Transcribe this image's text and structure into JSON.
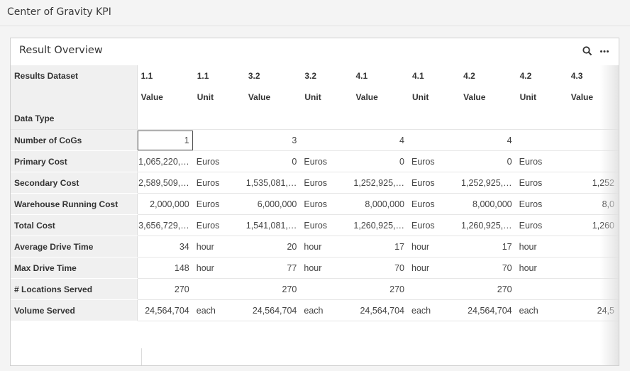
{
  "app": {
    "title": "Center of Gravity KPI"
  },
  "widget": {
    "title": "Result Overview",
    "search_icon": "search-icon",
    "more_icon": "more-icon"
  },
  "grid": {
    "header_rows": [
      {
        "label": "Results Dataset",
        "cells": [
          "1.1",
          "1.1",
          "3.2",
          "3.2",
          "4.1",
          "4.1",
          "4.2",
          "4.2",
          "4.3"
        ]
      },
      {
        "label": "",
        "cells": [
          "Value",
          "Unit",
          "Value",
          "Unit",
          "Value",
          "Unit",
          "Value",
          "Unit",
          "Value"
        ]
      },
      {
        "label": "Data Type",
        "cells": [
          "",
          "",
          "",
          "",
          "",
          "",
          "",
          "",
          ""
        ]
      }
    ],
    "rows": [
      {
        "label": "Number of CoGs",
        "cells": [
          "1",
          "",
          "3",
          "",
          "4",
          "",
          "4",
          "",
          ""
        ]
      },
      {
        "label": "Primary Cost",
        "cells": [
          "1,065,220,…",
          "Euros",
          "0",
          "Euros",
          "0",
          "Euros",
          "0",
          "Euros",
          ""
        ]
      },
      {
        "label": "Secondary Cost",
        "cells": [
          "2,589,509,…",
          "Euros",
          "1,535,081,…",
          "Euros",
          "1,252,925,…",
          "Euros",
          "1,252,925,…",
          "Euros",
          "1,252"
        ]
      },
      {
        "label": "Warehouse Running Cost",
        "cells": [
          "2,000,000",
          "Euros",
          "6,000,000",
          "Euros",
          "8,000,000",
          "Euros",
          "8,000,000",
          "Euros",
          "8,0"
        ]
      },
      {
        "label": "Total Cost",
        "cells": [
          "3,656,729,…",
          "Euros",
          "1,541,081,…",
          "Euros",
          "1,260,925,…",
          "Euros",
          "1,260,925,…",
          "Euros",
          "1,260"
        ]
      },
      {
        "label": "Average Drive Time",
        "cells": [
          "34",
          "hour",
          "20",
          "hour",
          "17",
          "hour",
          "17",
          "hour",
          ""
        ]
      },
      {
        "label": "Max Drive Time",
        "cells": [
          "148",
          "hour",
          "77",
          "hour",
          "70",
          "hour",
          "70",
          "hour",
          ""
        ]
      },
      {
        "label": "# Locations Served",
        "cells": [
          "270",
          "",
          "270",
          "",
          "270",
          "",
          "270",
          "",
          ""
        ]
      },
      {
        "label": "Volume Served",
        "cells": [
          "24,564,704",
          "each",
          "24,564,704",
          "each",
          "24,564,704",
          "each",
          "24,564,704",
          "each",
          "24,5"
        ]
      }
    ]
  }
}
